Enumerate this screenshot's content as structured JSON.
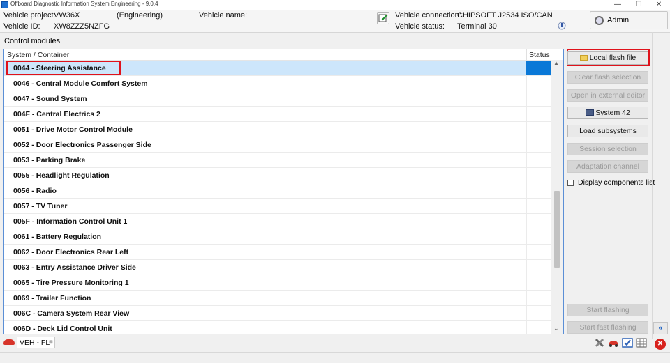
{
  "window": {
    "title": "Offboard Diagnostic Information System Engineering - 9.0.4",
    "min_glyph": "—",
    "max_glyph": "❐",
    "close_glyph": "✕"
  },
  "header": {
    "project_label": "Vehicle project:",
    "project_value": "VW36X",
    "project_mode": "(Engineering)",
    "name_label": "Vehicle name:",
    "id_label": "Vehicle ID:",
    "id_value": "XW8ZZZ5NZFG",
    "connection_label": "Vehicle connection:",
    "connection_value": "CHIPSOFT J2534 ISO/CAN",
    "status_label": "Vehicle status:",
    "status_value": "Terminal 30",
    "admin_label": "Admin"
  },
  "section_label": "Control modules",
  "table": {
    "col_system": "System / Container",
    "col_status": "Status",
    "rows": [
      "0044 - Steering Assistance",
      "0046 - Central Module Comfort System",
      "0047 - Sound System",
      "004F - Central Electrics 2",
      "0051 - Drive Motor Control Module",
      "0052 - Door Electronics Passenger Side",
      "0053 - Parking Brake",
      "0055 - Headlight Regulation",
      "0056 - Radio",
      "0057 - TV Tuner",
      "005F - Information Control Unit 1",
      "0061 - Battery Regulation",
      "0062 - Door Electronics Rear Left",
      "0063 - Entry Assistance Driver Side",
      "0065 - Tire Pressure Monitoring 1",
      "0069 - Trailer Function",
      "006C - Camera System Rear View",
      "006D - Deck Lid Control Unit"
    ],
    "selected_index": 0
  },
  "sidebar": {
    "local_flash_file": "Local flash file",
    "clear_flash_selection": "Clear flash selection",
    "open_external_editor": "Open in external editor",
    "system_42": "System 42",
    "load_subsystems": "Load subsystems",
    "session_selection": "Session selection",
    "adaptation_channel": "Adaptation channel",
    "display_components_list": "Display components list",
    "start_flashing": "Start flashing",
    "start_fast_flashing": "Start fast flashing"
  },
  "bottom": {
    "tab_label": "VEH - FL",
    "tab_close": "⊠"
  },
  "colors": {
    "selection_row": "#cde6fb",
    "selection_status": "#0a78d7",
    "highlight_box": "#e0121b",
    "table_border": "#5b8fd6"
  }
}
